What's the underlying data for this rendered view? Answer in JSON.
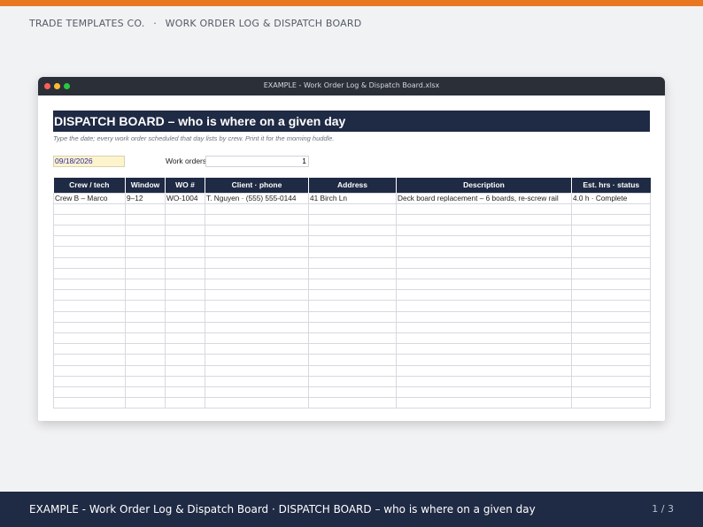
{
  "colors": {
    "accent": "#e87722",
    "navy": "#1f2a44"
  },
  "header": {
    "brand": "TRADE TEMPLATES CO.",
    "separator": "·",
    "title": "WORK ORDER LOG & DISPATCH BOARD"
  },
  "window": {
    "title": "EXAMPLE - Work Order Log & Dispatch Board.xlsx"
  },
  "sheet": {
    "banner": "DISPATCH BOARD – who is where on a given day",
    "subtitle": "Type the date; every work order scheduled that day lists by crew. Print it for the morning huddle.",
    "date_value": "09/18/2026",
    "work_orders_label": "Work orders",
    "work_orders_value": "1",
    "columns": [
      "Crew / tech",
      "Window",
      "WO #",
      "Client · phone",
      "Address",
      "Description",
      "Est. hrs · status"
    ],
    "rows": [
      [
        "Crew B – Marco",
        "9–12",
        "WO-1004",
        "T. Nguyen · (555) 555-0144",
        "41 Birch Ln",
        "Deck board replacement – 6 boards, re-screw rail",
        "4.0 h · Complete"
      ],
      [
        "",
        "",
        "",
        "",
        "",
        "",
        ""
      ],
      [
        "",
        "",
        "",
        "",
        "",
        "",
        ""
      ],
      [
        "",
        "",
        "",
        "",
        "",
        "",
        ""
      ],
      [
        "",
        "",
        "",
        "",
        "",
        "",
        ""
      ],
      [
        "",
        "",
        "",
        "",
        "",
        "",
        ""
      ],
      [
        "",
        "",
        "",
        "",
        "",
        "",
        ""
      ],
      [
        "",
        "",
        "",
        "",
        "",
        "",
        ""
      ],
      [
        "",
        "",
        "",
        "",
        "",
        "",
        ""
      ],
      [
        "",
        "",
        "",
        "",
        "",
        "",
        ""
      ],
      [
        "",
        "",
        "",
        "",
        "",
        "",
        ""
      ],
      [
        "",
        "",
        "",
        "",
        "",
        "",
        ""
      ],
      [
        "",
        "",
        "",
        "",
        "",
        "",
        ""
      ],
      [
        "",
        "",
        "",
        "",
        "",
        "",
        ""
      ],
      [
        "",
        "",
        "",
        "",
        "",
        "",
        ""
      ],
      [
        "",
        "",
        "",
        "",
        "",
        "",
        ""
      ],
      [
        "",
        "",
        "",
        "",
        "",
        "",
        ""
      ],
      [
        "",
        "",
        "",
        "",
        "",
        "",
        ""
      ],
      [
        "",
        "",
        "",
        "",
        "",
        "",
        ""
      ],
      [
        "",
        "",
        "",
        "",
        "",
        "",
        ""
      ]
    ]
  },
  "footer": {
    "text": "EXAMPLE - Work Order Log & Dispatch Board · DISPATCH BOARD – who is where on a given day",
    "page": "1 / 3"
  }
}
